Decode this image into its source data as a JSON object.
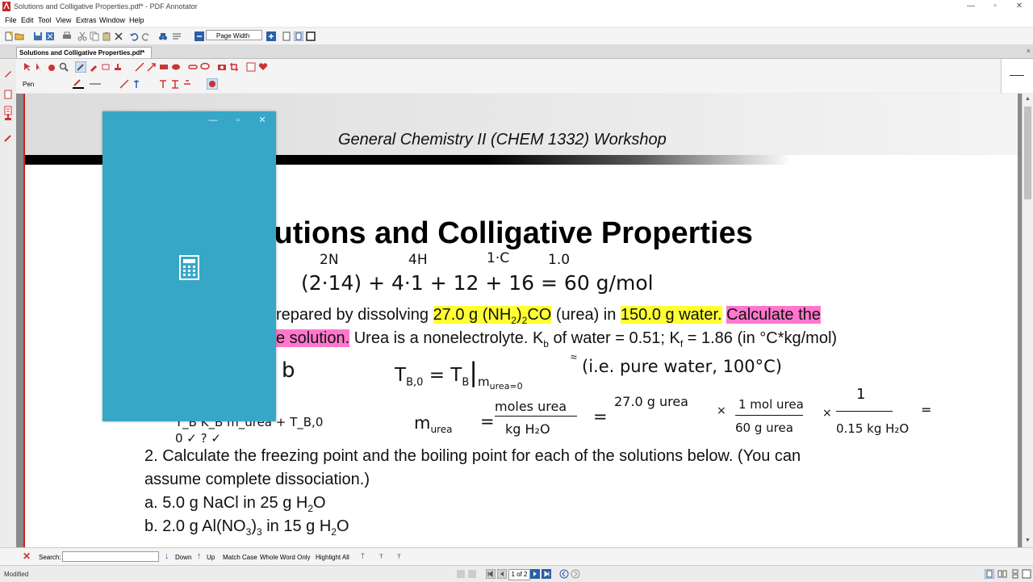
{
  "window": {
    "title": "Solutions and Colligative Properties.pdf* - PDF Annotator",
    "minimize": "—",
    "maximize": "▫",
    "close": "✕"
  },
  "menu": [
    "File",
    "Edit",
    "Tool",
    "View",
    "Extras",
    "Window",
    "Help"
  ],
  "toolbar": {
    "zoom_value": "Page Width"
  },
  "tab": {
    "label": "Solutions and Colligative Properties.pdf*",
    "close": "×"
  },
  "annot_toolbar": {
    "tool_label": "Pen"
  },
  "document": {
    "header_title": "General Chemistry II (CHEM 1332) Workshop",
    "main_heading": "lutions and Colligative Properties",
    "q1_line1": {
      "pre": "repared by dissolving ",
      "hl1": "27.0 g (NH",
      "hl1_sub": "2",
      "hl1_mid": ")",
      "hl1_sub2": "2",
      "hl1_end": "CO",
      "mid": " (urea) in ",
      "hl2": "150.0 g water.",
      "sp": " ",
      "hl3": "Calculate the"
    },
    "q1_line2": {
      "hl": "e solution.",
      "text": " Urea is a nonelectrolyte. K",
      "sub_b": "b",
      "text2": " of water = 0.51; K",
      "sub_f": "f",
      "text3": " = 1.86 (in °C*kg/mol)"
    },
    "q2_line1": "2. Calculate the freezing point and the boiling point for each of the solutions below. (You can",
    "q2_line2": "assume complete dissociation.)",
    "q2a": {
      "pre": "a. 5.0 g NaCl in 25 g H",
      "sub": "2",
      "post": "O"
    },
    "q2b": {
      "pre": "b. 2.0 g Al(NO",
      "sub": "3",
      "mid": ")",
      "sub2": "3",
      "post": " in 15 g H",
      "sub3": "2",
      "end": "O"
    },
    "handwriting": {
      "labels_top": [
        "2N",
        "4H",
        "1·C",
        "1.0"
      ],
      "molar_mass": "(2·14) + 4·1 + 12 + 16 = 60 g/mol",
      "tb0": "T",
      "tb0_sub": "B,0",
      "eq1": " = T",
      "eq1_sub": "B",
      "eq1_bar": "|",
      "eq1_cond": "m",
      "eq1_cond_sub": "urea=0",
      "eq1_note": "(i.e. pure water, 100°C)",
      "b_letter": "b",
      "m_urea": "m",
      "m_urea_sub": "urea",
      "eq_sign": "=",
      "frac1_num": "moles urea",
      "frac1_den": "kg H₂O",
      "frac2_num": "27.0 g urea",
      "times": "×",
      "frac3_num": "1 mol urea",
      "frac3_den": "60 g urea",
      "frac4_num": "1",
      "frac4_den": "0.15 kg H₂O",
      "under_left": "T_B   K_B  m_urea + T_B,0",
      "under_marks": "0      ✓    ?       ✓"
    }
  },
  "search": {
    "label": "Search:",
    "placeholder": "",
    "down": "Down",
    "up": "Up",
    "match_case": "Match Case",
    "whole_word": "Whole Word Only",
    "highlight_all": "Highlight All"
  },
  "status": {
    "text": "Modified",
    "page": "1 of 2"
  },
  "colors": {
    "calc_bg": "#37a7c8",
    "highlight_yellow": "#ffff33",
    "highlight_pink": "#ff77cc"
  }
}
